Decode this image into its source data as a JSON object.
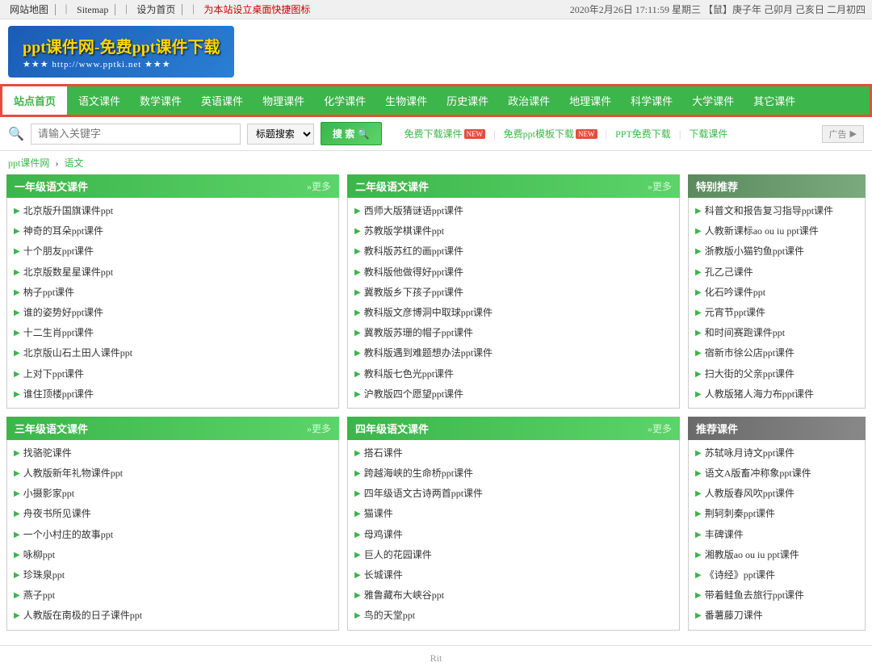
{
  "topbar": {
    "left_links": [
      {
        "label": "网站地图",
        "href": "#"
      },
      {
        "label": "Sitemap",
        "href": "#"
      },
      {
        "label": "设为首页",
        "href": "#"
      },
      {
        "label": "为本站设立桌面快捷图标",
        "href": "#",
        "highlight": true
      }
    ],
    "right_text": "2020年2月26日 17:11:59 星期三 【鼠】庚子年 己卯月 己亥日 二月初四"
  },
  "logo": {
    "title": "ppt课件网-免费ppt课件下载",
    "url": "★★★ http://www.pptki.net ★★★"
  },
  "nav": {
    "home_label": "站点首页",
    "items": [
      {
        "label": "语文课件"
      },
      {
        "label": "数学课件"
      },
      {
        "label": "英语课件"
      },
      {
        "label": "物理课件"
      },
      {
        "label": "化学课件"
      },
      {
        "label": "生物课件"
      },
      {
        "label": "历史课件"
      },
      {
        "label": "政治课件"
      },
      {
        "label": "地理课件"
      },
      {
        "label": "科学课件"
      },
      {
        "label": "大学课件"
      },
      {
        "label": "其它课件"
      }
    ]
  },
  "search": {
    "placeholder": "请输入关键字",
    "select_option": "标题搜索",
    "button_label": "搜索",
    "links": [
      {
        "label": "免费下载课件",
        "badge": "NEW"
      },
      {
        "label": "免费ppt模板下载",
        "badge": "NEW"
      },
      {
        "label": "PPT免费下载"
      },
      {
        "label": "下载课件"
      }
    ],
    "ad_label": "广告"
  },
  "breadcrumb": {
    "home": "ppt课件网",
    "separator": "›",
    "current": "语文"
  },
  "grade1": {
    "header": "一年级语文课件",
    "more": "»更多",
    "items": [
      "北京版升国旗课件ppt",
      "神奇的耳朵ppt课件",
      "十个朋友ppt课件",
      "北京版数星星课件ppt",
      "枘子ppt课件",
      "谁的姿势好ppt课件",
      "十二生肖ppt课件",
      "北京版山石土田人课件ppt",
      "上对下ppt课件",
      "谁住顶楼ppt课件"
    ]
  },
  "grade2": {
    "header": "二年级语文课件",
    "more": "»更多",
    "items": [
      "西师大版猜谜语ppt课件",
      "苏教版学棋课件ppt",
      "教科版苏红的画ppt课件",
      "教科版他做得好ppt课件",
      "冀教版乡下孩子ppt课件",
      "教科版文彦博洞中取球ppt课件",
      "冀教版苏珊的帽子ppt课件",
      "教科版遇到难题想办法ppt课件",
      "教科版七色光ppt课件",
      "沪教版四个愿望ppt课件"
    ]
  },
  "special": {
    "header": "特别推荐",
    "items": [
      "科普文和报告复习指导ppt课件",
      "人教新课标ao ou iu ppt课件",
      "浙教版小猫钓鱼ppt课件",
      "孔乙己课件",
      "化石吟课件ppt",
      "元宵节ppt课件",
      "和时间赛跑课件ppt",
      "宿新市徐公店ppt课件",
      "扫大街的父亲ppt课件",
      "人教版猪人海力布ppt课件"
    ]
  },
  "grade3": {
    "header": "三年级语文课件",
    "more": "»更多",
    "items": [
      "找骆驼课件",
      "人教版新年礼物课件ppt",
      "小摄影家ppt",
      "舟夜书所见课件",
      "一个小村庄的故事ppt",
      "咏柳ppt",
      "珍珠泉ppt",
      "燕子ppt",
      "人教版在南极的日子课件ppt"
    ]
  },
  "grade4": {
    "header": "四年级语文课件",
    "more": "»更多",
    "items": [
      "搭石课件",
      "跨越海峡的生命桥ppt课件",
      "四年级语文古诗两首ppt课件",
      "猫课件",
      "母鸡课件",
      "巨人的花园课件",
      "长城课件",
      "雅鲁藏布大峡谷ppt",
      "鸟的天堂ppt"
    ]
  },
  "recommend": {
    "header": "推荐课件",
    "items": [
      "苏轼咏月诗文ppt课件",
      "语文A版畜冲称象ppt课件",
      "人教版春风吹ppt课件",
      "荆轲刺秦ppt课件",
      "丰碑课件",
      "湘教版ao ou iu ppt课件",
      "《诗经》ppt课件",
      "带着鲑鱼去旅行ppt课件",
      "番薯藤刀课件"
    ]
  },
  "bottom": {
    "text": "Rit"
  }
}
